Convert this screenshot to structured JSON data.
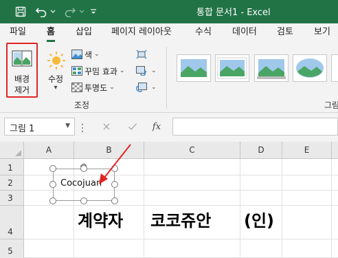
{
  "window": {
    "title": "통합 문서1  -  Excel"
  },
  "colors": {
    "accent": "#217346",
    "highlight": "#e02424",
    "arrow": "#e02424"
  },
  "tabs": [
    {
      "label": "파일",
      "active": false
    },
    {
      "label": "홈",
      "active": true
    },
    {
      "label": "삽입",
      "active": false
    },
    {
      "label": "페이지 레이아웃",
      "active": false
    },
    {
      "label": "수식",
      "active": false
    },
    {
      "label": "데이터",
      "active": false
    },
    {
      "label": "검토",
      "active": false
    },
    {
      "label": "보기",
      "active": false
    }
  ],
  "ribbon": {
    "remove_background": {
      "line1": "배경",
      "line2": "제거",
      "icon": "remove-background-icon"
    },
    "corrections": {
      "label": "수정",
      "icon": "corrections-icon"
    },
    "color": {
      "label": "색",
      "icon": "color-icon"
    },
    "artistic_effects": {
      "label": "꾸밈 효과",
      "icon": "artistic-effects-icon"
    },
    "transparency": {
      "label": "투명도",
      "icon": "transparency-icon"
    },
    "compress": {
      "icon": "compress-pictures-icon"
    },
    "change_picture": {
      "icon": "change-picture-icon"
    },
    "reset_picture": {
      "icon": "reset-picture-icon"
    },
    "group_adjust": "조정",
    "group_styles": "그림"
  },
  "formula_bar": {
    "name_box": "그림 1",
    "cancel_icon": "cancel-icon",
    "enter_icon": "enter-icon",
    "fx_label": "fx",
    "value": ""
  },
  "sheet": {
    "columns": [
      "A",
      "B",
      "C",
      "D",
      "E"
    ],
    "rows": [
      "1",
      "2",
      "3",
      "4",
      "5"
    ],
    "row4_texts": [
      "계약자",
      "코코쥬안",
      "(인)"
    ]
  },
  "picture": {
    "text": "Cocojuan"
  }
}
